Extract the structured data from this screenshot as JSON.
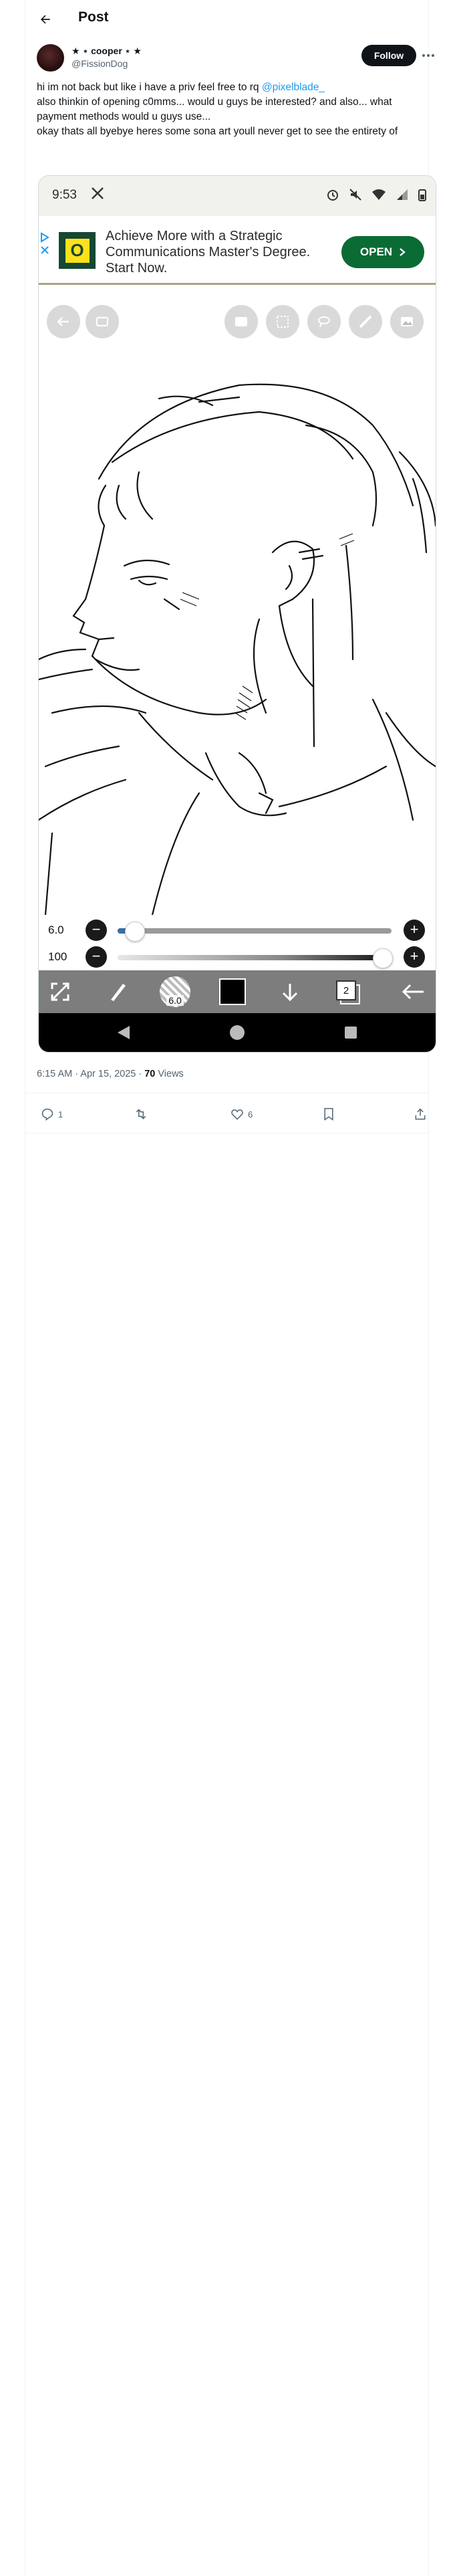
{
  "header": {
    "title": "Post"
  },
  "author": {
    "name": "★ ⋆ cooper ⋆ ★",
    "handle": "@FissionDog",
    "follow_label": "Follow"
  },
  "tweet": {
    "lines": [
      {
        "text": "hi im not back but like i have a priv feel free to rq ",
        "mention": "@pixelblade_"
      },
      {
        "text": "also thinkin of opening c0mms... would u guys be interested? and also... what payment methods would u guys use..."
      },
      {
        "text": "okay thats all byebye heres some sona art youll never get to see the entirety of"
      }
    ]
  },
  "screenshot": {
    "status_time": "9:53",
    "ad": {
      "text": "Achieve More with a Strategic Communications Master's Degree. Start Now.",
      "cta": "OPEN",
      "logo_letter": "O"
    },
    "sliders": [
      {
        "label": "6.0",
        "value": 0.03
      },
      {
        "label": "100",
        "value": 1.0
      }
    ],
    "brush_size": "6.0",
    "layer_count": "2",
    "colors": {
      "accent": "#3a6ea5",
      "ad_cta": "#0b6b34",
      "logo_bg": "#154733",
      "logo_fg": "#fee11a"
    }
  },
  "meta": {
    "time": "6:15 AM · Apr 15, 2025 · ",
    "views_count": "70",
    "views_label": " Views"
  },
  "actions": {
    "replies": "1",
    "reposts": "",
    "likes": "6"
  },
  "colors": {
    "mention": "#1d9bf0",
    "secondary_text": "#536471",
    "follow_bg": "#0f1419"
  }
}
